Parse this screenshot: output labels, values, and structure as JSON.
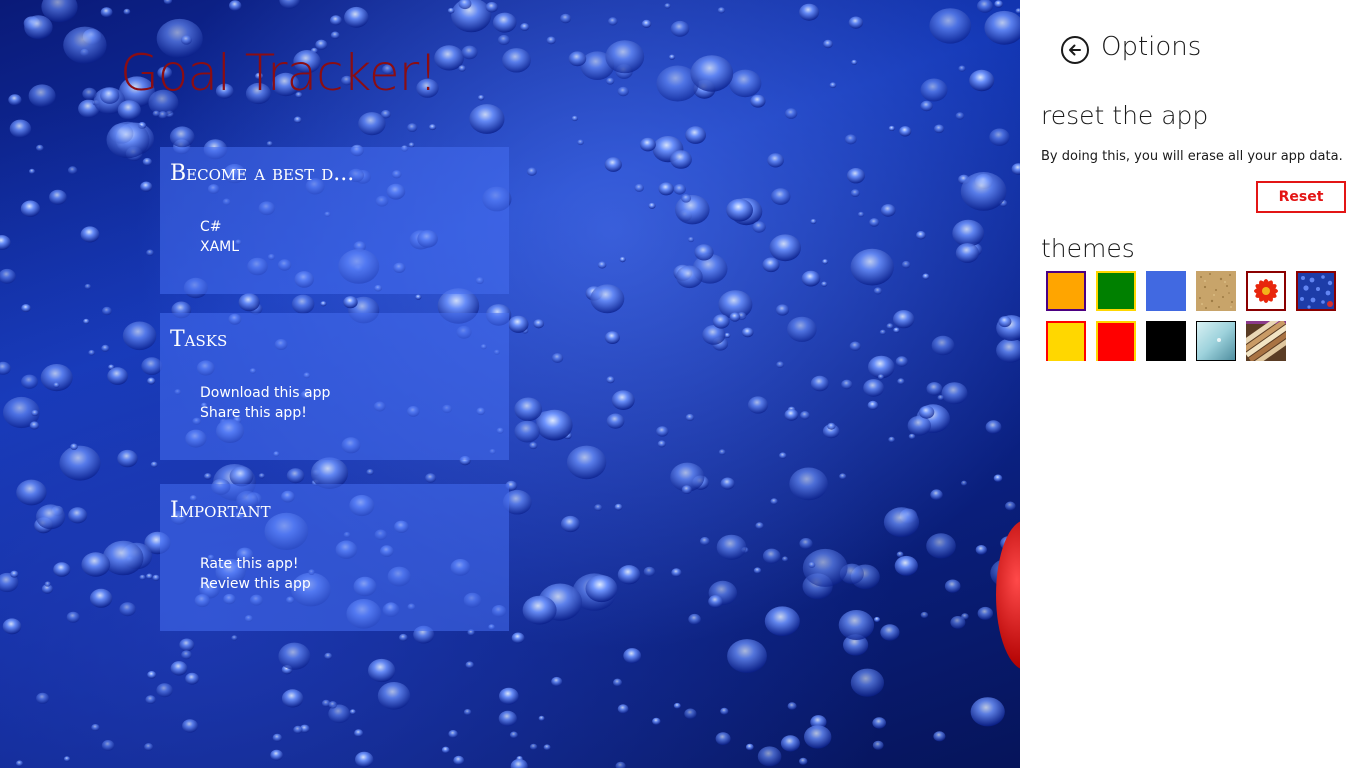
{
  "app": {
    "title": "Goal Tracker!",
    "title_color": "#8b0d12"
  },
  "groups": [
    {
      "title": "Become a best d...",
      "items": [
        "C#",
        "XAML"
      ]
    },
    {
      "title": "Tasks",
      "items": [
        "Download this app",
        "Share this app!"
      ]
    },
    {
      "title": "Important",
      "items": [
        "Rate this app!",
        "Review this app"
      ]
    }
  ],
  "options": {
    "title": "Options",
    "back_icon": "back-arrow-icon",
    "reset": {
      "heading": "reset the app",
      "description": "By doing this, you will erase all your app data.",
      "button_label": "Reset",
      "accent": "#e31515"
    },
    "themes": {
      "heading": "themes",
      "swatches": [
        {
          "name": "orange",
          "fill": "#ffa500"
        },
        {
          "name": "green",
          "fill": "#008000"
        },
        {
          "name": "royal-blue",
          "fill": "#4169e1"
        },
        {
          "name": "sand-texture",
          "fill": "#c8a46a"
        },
        {
          "name": "red-flower",
          "fill": "#ffffff"
        },
        {
          "name": "water-drops",
          "fill": "#1d3ca8"
        },
        {
          "name": "gold",
          "fill": "#ffd700"
        },
        {
          "name": "red",
          "fill": "#ff0000"
        },
        {
          "name": "black",
          "fill": "#000000"
        },
        {
          "name": "light-aqua",
          "fill": "#a6d8e0"
        },
        {
          "name": "books",
          "fill": "#8a6a4a"
        }
      ]
    }
  }
}
